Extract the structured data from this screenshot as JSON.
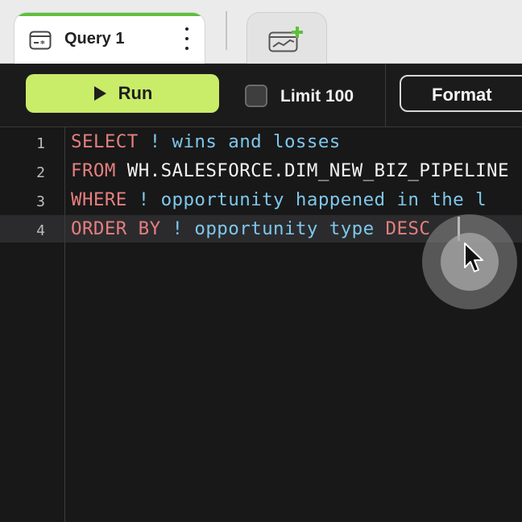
{
  "tabs": {
    "active": {
      "title": "Query 1",
      "icon": "query-tab-icon",
      "accent_color": "#5fbf3a"
    },
    "new_tab": {
      "icon": "add-chart-icon",
      "accent_color": "#5fbf3a"
    }
  },
  "toolbar": {
    "run_label": "Run",
    "run_color": "#c9ec69",
    "limit_label": "Limit 100",
    "limit_checked": false,
    "format_label": "Format"
  },
  "editor": {
    "lines": [
      {
        "number": "1",
        "keyword": "SELECT",
        "ident": "",
        "comment": " ! wins and losses"
      },
      {
        "number": "2",
        "keyword": "FROM",
        "ident": " WH.SALESFORCE.DIM_NEW_BIZ_PIPELINE",
        "comment": ""
      },
      {
        "number": "3",
        "keyword": "WHERE",
        "ident": "",
        "comment": " ! opportunity happened in the l"
      },
      {
        "number": "4",
        "keyword": "ORDER BY",
        "ident": "",
        "comment": " ! opportunity type ",
        "trailing_keyword": "DESC"
      }
    ],
    "active_line": 4,
    "colors": {
      "keyword": "#e67f7f",
      "comment": "#7ec7ec",
      "identifier": "#f2f2f2"
    }
  }
}
